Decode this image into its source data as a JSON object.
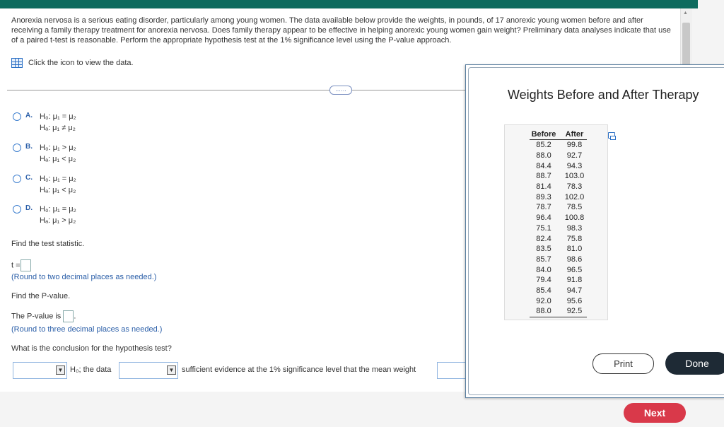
{
  "question": {
    "intro": "Anorexia nervosa is a serious eating disorder, particularly among young women. The data available below provide the weights, in pounds, of 17 anorexic young women before and after receiving a family therapy treatment for anorexia nervosa. Does family therapy appear to be effective in helping anorexic young women gain weight? Preliminary data analyses indicate that use of a paired t-test is reasonable. Perform the appropriate hypothesis test at the 1% significance level using the P-value approach.",
    "data_link": "Click the icon to view the data.",
    "more_label": "……"
  },
  "options": [
    {
      "letter": "A.",
      "h0": "H₀: μ₁ = μ₂",
      "ha": "Hₐ: μ₁ ≠ μ₂"
    },
    {
      "letter": "B.",
      "h0": "H₀: μ₁ > μ₂",
      "ha": "Hₐ: μ₁ < μ₂"
    },
    {
      "letter": "C.",
      "h0": "H₀: μ₁ = μ₂",
      "ha": "Hₐ: μ₁ < μ₂"
    },
    {
      "letter": "D.",
      "h0": "H₀: μ₁ = μ₂",
      "ha": "Hₐ: μ₁ > μ₂"
    }
  ],
  "test_stat": {
    "prompt": "Find the test statistic.",
    "label": "t =",
    "hint": "(Round to two decimal places as needed.)"
  },
  "pvalue": {
    "prompt": "Find the P-value.",
    "label": "The P-value is",
    "suffix": ".",
    "hint": "(Round to three decimal places as needed.)"
  },
  "conclusion": {
    "prompt": "What is the conclusion for the hypothesis test?",
    "text1": "H₀; the data",
    "text2": "sufficient evidence at the 1% significance level that the mean weight"
  },
  "modal": {
    "title": "Weights Before and After Therapy",
    "col_before": "Before",
    "col_after": "After",
    "rows": [
      [
        "85.2",
        "99.8"
      ],
      [
        "88.0",
        "92.7"
      ],
      [
        "84.4",
        "94.3"
      ],
      [
        "88.7",
        "103.0"
      ],
      [
        "81.4",
        "78.3"
      ],
      [
        "89.3",
        "102.0"
      ],
      [
        "78.7",
        "78.5"
      ],
      [
        "96.4",
        "100.8"
      ],
      [
        "75.1",
        "98.3"
      ],
      [
        "82.4",
        "75.8"
      ],
      [
        "83.5",
        "81.0"
      ],
      [
        "85.7",
        "98.6"
      ],
      [
        "84.0",
        "96.5"
      ],
      [
        "79.4",
        "91.8"
      ],
      [
        "85.4",
        "94.7"
      ],
      [
        "92.0",
        "95.6"
      ],
      [
        "88.0",
        "92.5"
      ]
    ],
    "print_label": "Print",
    "done_label": "Done"
  },
  "next_label": "Next",
  "colors": {
    "header": "#0d6b5e",
    "next": "#d9394a",
    "done": "#1e2a35",
    "link": "#2a5ea8"
  }
}
